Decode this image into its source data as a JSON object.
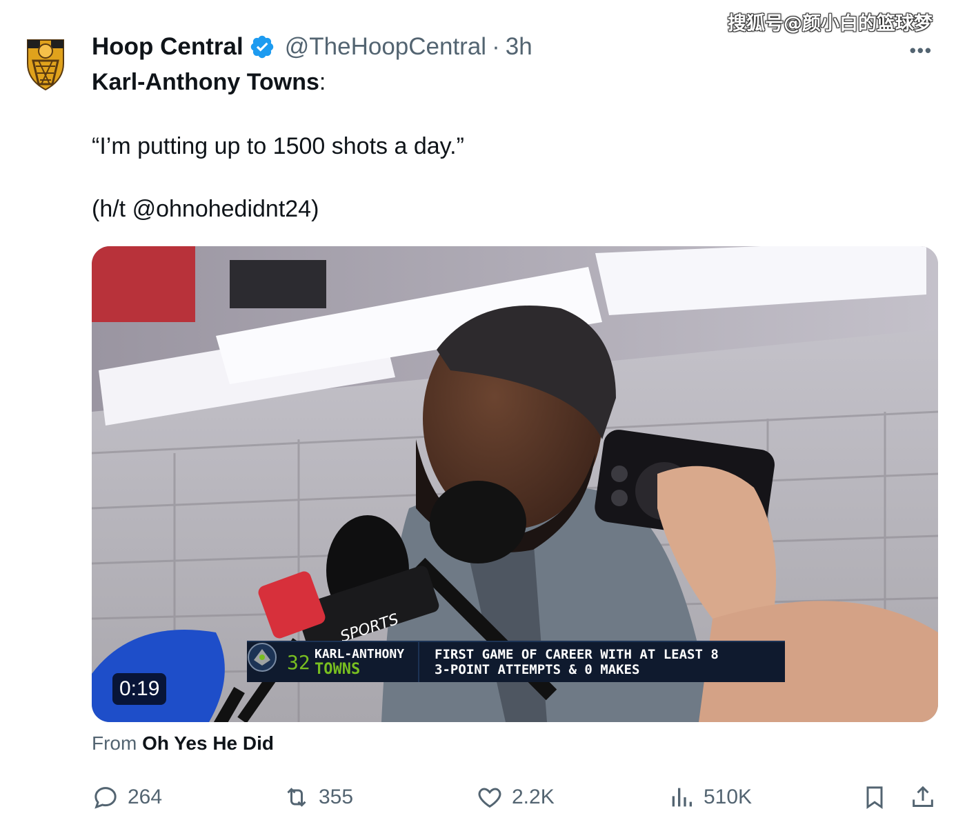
{
  "watermark": "搜狐号@颜小白的篮球梦",
  "author": {
    "display_name": "Hoop Central",
    "handle": "@TheHoopCentral",
    "separator": "·",
    "time": "3h",
    "verified": true,
    "avatar_icon": "hoop-central-shield-logo"
  },
  "more_label": "•••",
  "tweet": {
    "line1_bold": "Karl-Anthony Towns",
    "line1_rest": ":",
    "line2": "“I’m putting up to 1500 shots a day.”",
    "line3": "(h/t @ohnohedidnt24)"
  },
  "media": {
    "duration": "0:19",
    "lower_third": {
      "number": "32",
      "first_name": "KARL-ANTHONY",
      "last_name": "TOWNS",
      "stat_line1": "FIRST GAME OF CAREER WITH AT LEAST 8",
      "stat_line2": "3-POINT ATTEMPTS & 0 MAKES"
    },
    "mic_flag_text": "SPORTS"
  },
  "source": {
    "prefix": "From",
    "name": "Oh Yes He Did"
  },
  "actions": {
    "replies": "264",
    "retweets": "355",
    "likes": "2.2K",
    "views": "510K"
  },
  "colors": {
    "text_primary": "#0f1419",
    "text_secondary": "#536471",
    "verified_blue": "#1d9bf0",
    "timberwolves_green": "#78be20"
  }
}
